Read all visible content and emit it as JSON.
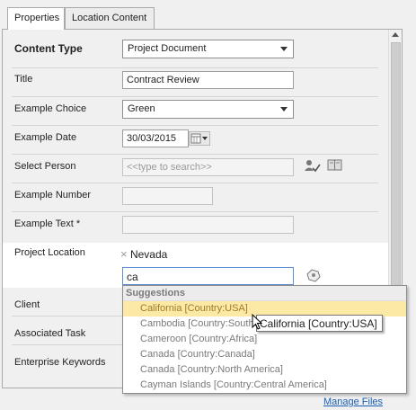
{
  "tabs": [
    {
      "label": "Properties",
      "active": true
    },
    {
      "label": "Location Content",
      "active": false
    }
  ],
  "form": {
    "content_type": {
      "label": "Content Type",
      "value": "Project Document"
    },
    "title": {
      "label": "Title",
      "value": "Contract Review"
    },
    "example_choice": {
      "label": "Example Choice",
      "value": "Green"
    },
    "example_date": {
      "label": "Example Date",
      "value": "30/03/2015"
    },
    "select_person": {
      "label": "Select Person",
      "placeholder": "<<type to search>>"
    },
    "example_number": {
      "label": "Example Number",
      "value": ""
    },
    "example_text": {
      "label": "Example Text *",
      "value": ""
    },
    "project_location": {
      "label": "Project Location",
      "selected_tag": "Nevada",
      "input_value": "ca"
    },
    "client": {
      "label": "Client"
    },
    "associated_task": {
      "label": "Associated Task"
    },
    "enterprise_keywords": {
      "label": "Enterprise Keywords"
    }
  },
  "suggestions": {
    "header": "Suggestions",
    "items": [
      "California [Country:USA]",
      "Cambodia [Country:Southeast Asia]",
      "Cameroon [Country:Africa]",
      "Canada [Country:Canada]",
      "Canada [Country:North America]",
      "Cayman Islands [Country:Central America]"
    ],
    "highlighted_index": 0,
    "tooltip": "California [Country:USA]"
  },
  "footer": {
    "manage_files": "Manage Files"
  },
  "colors": {
    "highlight": "#fbe9a5",
    "link": "#1a5fb4"
  }
}
